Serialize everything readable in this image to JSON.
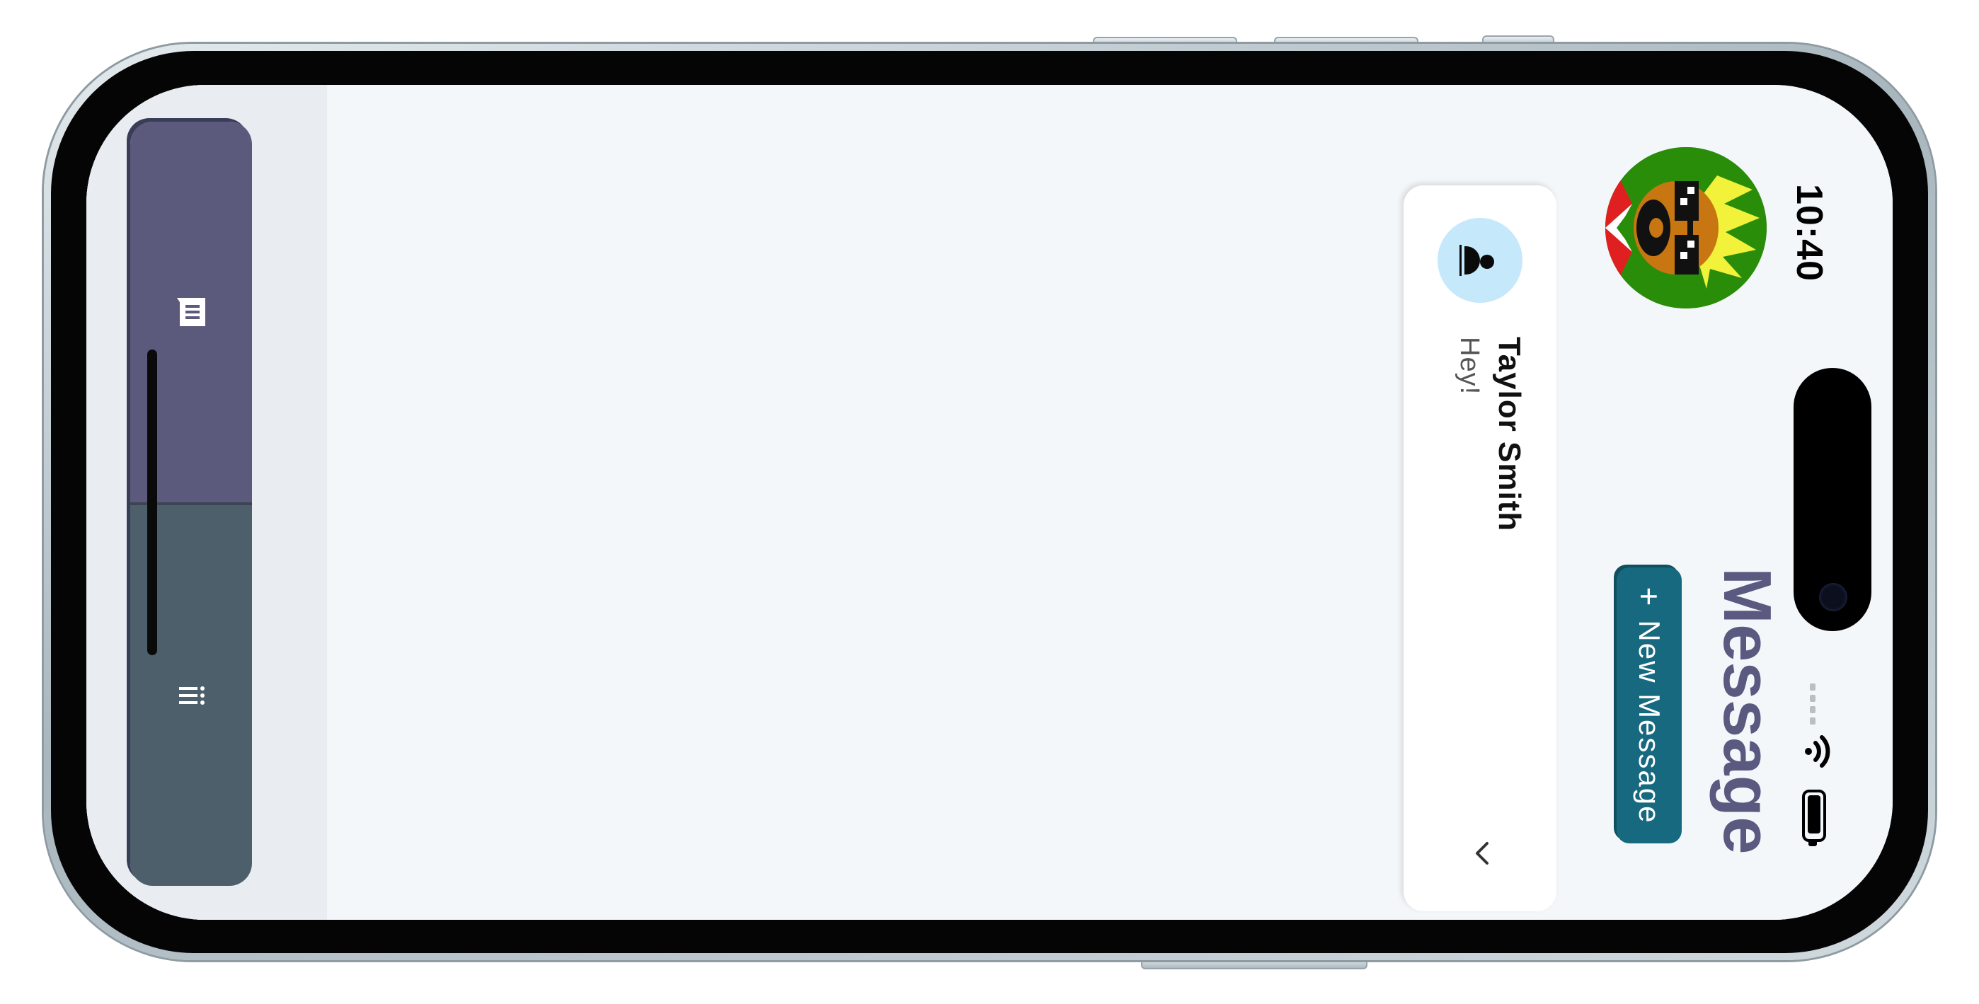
{
  "status_bar": {
    "time": "10:40"
  },
  "header": {
    "title": "Message",
    "new_message_button": {
      "icon": "+",
      "label": "New Message"
    }
  },
  "conversations": [
    {
      "name": "Taylor Smith",
      "preview": "Hey!",
      "avatar_icon": "person-icon",
      "expand_icon": "chevron-down-icon"
    }
  ],
  "bottom_nav": {
    "tabs": [
      {
        "id": "messages",
        "icon": "message-icon",
        "color": "#5b5a7c"
      },
      {
        "id": "more",
        "icon": "dots-icon",
        "color": "#4c5f6a"
      }
    ]
  },
  "colors": {
    "accent": "#16697e",
    "title": "#5a5a80",
    "background": "#f4f7fa",
    "avatar_bg": "#2a8d0a",
    "contact_avatar_bg": "#c6e8fb"
  }
}
